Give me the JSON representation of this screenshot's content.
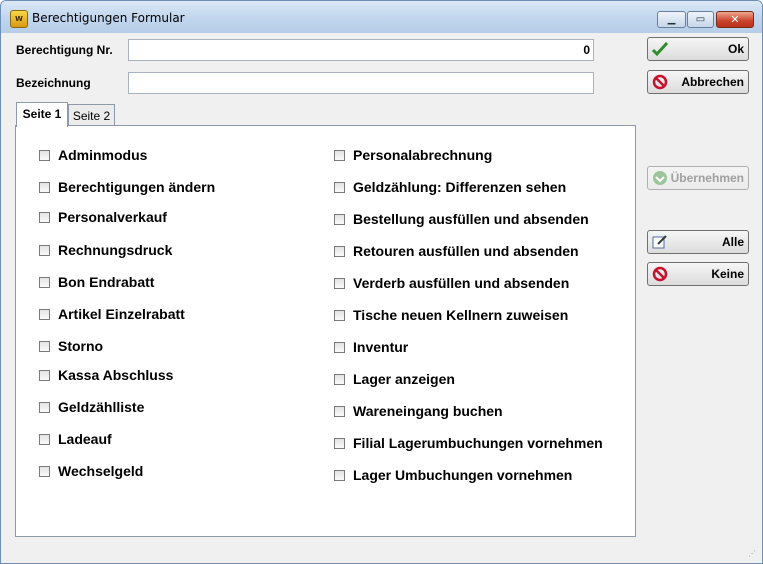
{
  "window": {
    "title": "Berechtigungen Formular"
  },
  "form": {
    "nr_label": "Berechtigung Nr.",
    "nr_value": "0",
    "desc_label": "Bezeichnung",
    "desc_value": ""
  },
  "tabs": [
    {
      "label": "Seite 1",
      "active": true
    },
    {
      "label": "Seite 2",
      "active": false
    }
  ],
  "permissions_left": [
    "Adminmodus",
    "Berechtigungen ändern",
    "Personalverkauf",
    "Rechnungsdruck",
    "Bon Endrabatt",
    "Artikel Einzelrabatt",
    "Storno",
    "Kassa Abschluss",
    "Geldzählliste",
    "Ladeauf",
    "Wechselgeld"
  ],
  "permissions_right": [
    "Personalabrechnung",
    "Geldzählung: Differenzen sehen",
    "Bestellung ausfüllen und absenden",
    "Retouren ausfüllen und absenden",
    "Verderb ausfüllen und absenden",
    "Tische neuen Kellnern zuweisen",
    "Inventur",
    "Lager anzeigen",
    "Wareneingang buchen",
    "Filial Lagerumbuchungen vornehmen",
    "Lager Umbuchungen vornehmen"
  ],
  "buttons": {
    "ok": "Ok",
    "cancel": "Abbrechen",
    "apply": "Übernehmen",
    "all": "Alle",
    "none": "Keine"
  },
  "colors": {
    "accent_green": "#2e8b2e",
    "cancel_red": "#c8102e"
  }
}
